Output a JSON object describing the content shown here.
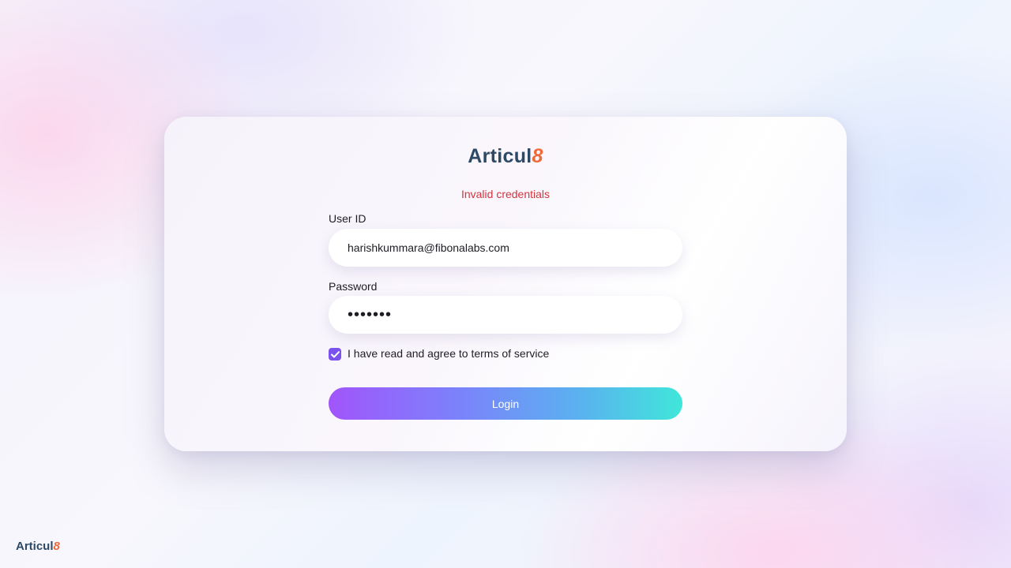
{
  "brand": {
    "name": "Articul",
    "mark": "8"
  },
  "alert": {
    "error_text": "Invalid credentials"
  },
  "form": {
    "user_id": {
      "label": "User ID",
      "value": "harishkummara@fibonalabs.com"
    },
    "password": {
      "label": "Password",
      "value": "•••••••"
    },
    "terms": {
      "checked": true,
      "label": "I have read and agree to terms of service"
    },
    "login_label": "Login"
  },
  "footer": {
    "brand_name": "Articul",
    "brand_mark": "8"
  },
  "colors": {
    "brand_text": "#2c4a66",
    "brand_accent": "#ee6a3a",
    "error": "#d0363e",
    "checkbox": "#7b52ee",
    "button_gradient_start": "#a155fb",
    "button_gradient_end": "#40e6da"
  }
}
